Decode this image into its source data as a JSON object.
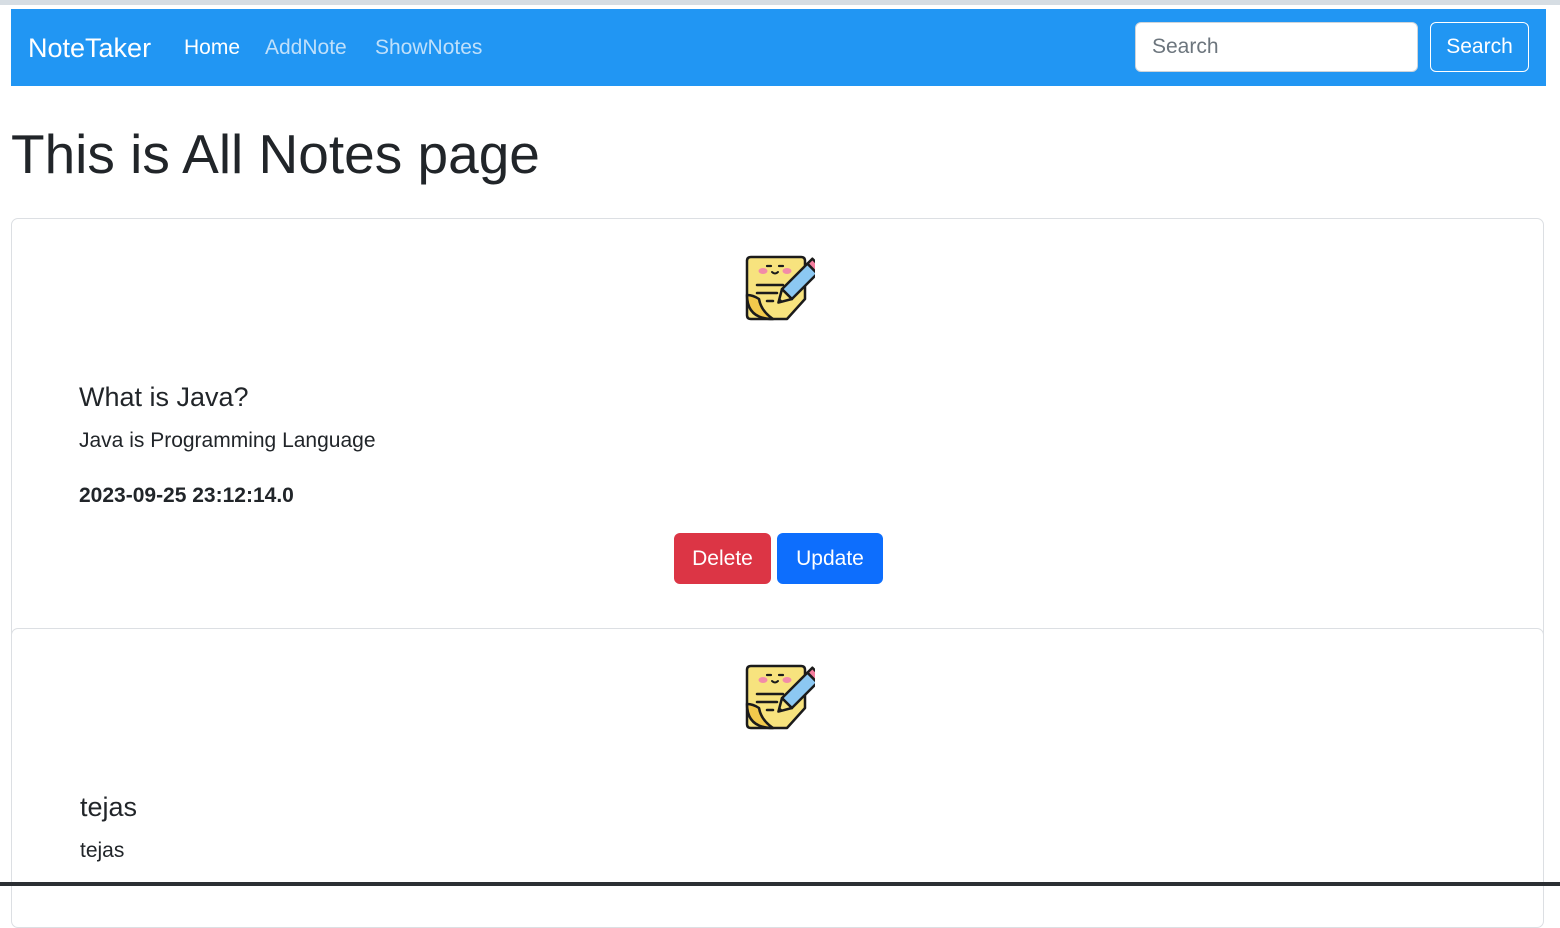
{
  "navbar": {
    "brand": "NoteTaker",
    "links": [
      {
        "label": "Home",
        "active": true
      },
      {
        "label": "AddNote",
        "active": false
      },
      {
        "label": "ShowNotes",
        "active": false
      }
    ],
    "search": {
      "placeholder": "Search",
      "value": "",
      "button_label": "Search"
    },
    "color": "#2196f3"
  },
  "page": {
    "title": "This is All Notes page"
  },
  "notes": [
    {
      "icon": "sticky-note-pencil-icon",
      "title": "What is Java?",
      "content": "Java is Programming Language",
      "date": "2023-09-25 23:12:14.0",
      "delete_label": "Delete",
      "update_label": "Update"
    },
    {
      "icon": "sticky-note-pencil-icon",
      "title": "tejas",
      "content": "tejas"
    }
  ],
  "colors": {
    "delete": "#dc3545",
    "update": "#0d6efd"
  }
}
